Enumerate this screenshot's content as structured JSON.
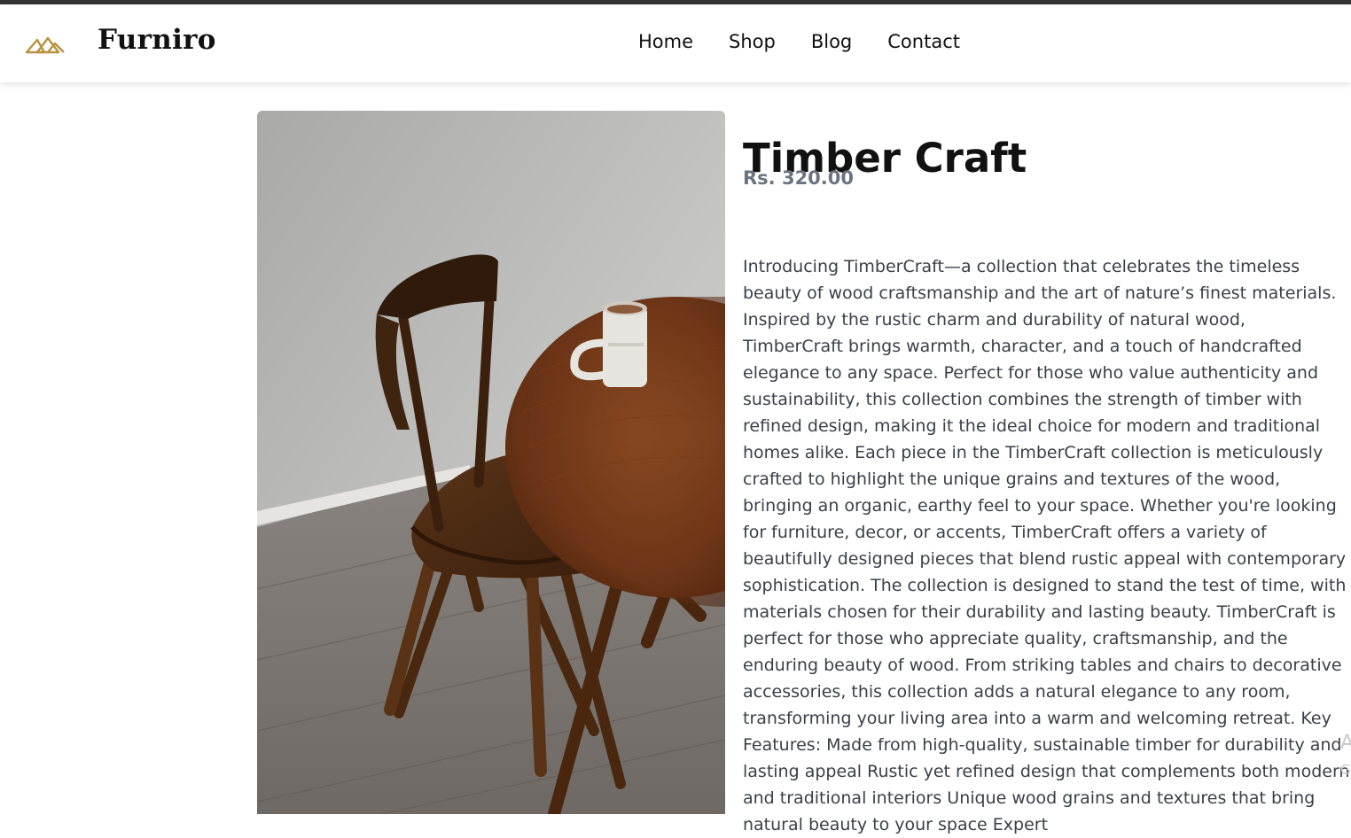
{
  "brand": {
    "name": "Furniro",
    "logo_icon": "mountain-logo-icon",
    "logo_color": "#b8923f"
  },
  "nav": {
    "items": [
      "Home",
      "Shop",
      "Blog",
      "Contact"
    ]
  },
  "product": {
    "title": "Timber Craft",
    "price": "Rs. 320.00",
    "image": "wooden-chair-and-round-table-photo",
    "description": "Introducing TimberCraft—a collection that celebrates the timeless beauty of wood craftsmanship and the art of nature’s finest materials. Inspired by the rustic charm and durability of natural wood, TimberCraft brings warmth, character, and a touch of handcrafted elegance to any space. Perfect for those who value authenticity and sustainability, this collection combines the strength of timber with refined design, making it the ideal choice for modern and traditional homes alike. Each piece in the TimberCraft collection is meticulously crafted to highlight the unique grains and textures of the wood, bringing an organic, earthy feel to your space. Whether you're looking for furniture, decor, or accents, TimberCraft offers a variety of beautifully designed pieces that blend rustic appeal with contemporary sophistication. The collection is designed to stand the test of time, with materials chosen for their durability and lasting beauty. TimberCraft is perfect for those who appreciate quality, craftsmanship, and the enduring beauty of wood. From striking tables and chairs to decorative accessories, this collection adds a natural elegance to any room, transforming your living area into a warm and welcoming retreat. Key Features: Made from high-quality, sustainable timber for durability and lasting appeal Rustic yet refined design that complements both modern and traditional interiors Unique wood grains and textures that bring natural beauty to your space Expert"
  },
  "edge_overlay": {
    "line1": "A",
    "line2": "G"
  },
  "colors": {
    "topline": "#333333",
    "price": "#6b7382",
    "text": "#3a3f47"
  }
}
